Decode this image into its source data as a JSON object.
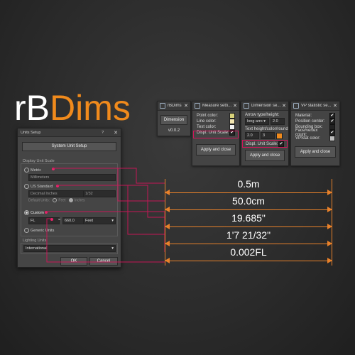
{
  "logo": {
    "part1": "rB",
    "part2": "Dims"
  },
  "colors": {
    "accent": "#f08a1c",
    "highlight": "#d4145a",
    "dimension_line": "#e8812a"
  },
  "panels": {
    "rbdims": {
      "title": "rBDims",
      "button": "Dimension",
      "version": "v0.0.2"
    },
    "measure": {
      "title": "Measure setti...",
      "rows": [
        "Point color:",
        "Line color:",
        "Text color:",
        "Displ. Unit Scale:"
      ],
      "button": "Apply and close"
    },
    "dimension": {
      "title": "Dimension se...",
      "arrow_label": "Arrow type/height:",
      "arrow_type": "long arro",
      "arrow_height": "2.0",
      "text_label": "Text height/color/round:",
      "text_height": "2.0",
      "text_round": "3",
      "scale_label": "Displ. Unit Scale:",
      "button": "Apply and close"
    },
    "vpstat": {
      "title": "VP statistic se...",
      "rows": [
        "Material:",
        "Position center:",
        "Bounding box:",
        "Face/vertex count:",
        "VPStat color:"
      ],
      "button": "Apply and close"
    }
  },
  "units_dialog": {
    "title": "Units Setup",
    "help": "?",
    "system_button": "System Unit Setup",
    "display_group": "Display Unit Scale",
    "metric_label": "Metric",
    "metric_value": "Millimeters",
    "us_label": "US Standard",
    "us_value": "Decimal Inches",
    "us_fraction": "1/32",
    "default_units": "Default Units:",
    "feet": "Feet",
    "inches": "Inches",
    "custom_label": "Custom",
    "custom_name": "FL",
    "custom_equals": "=",
    "custom_value": "660.0",
    "custom_unit": "Feet",
    "generic_label": "Generic Units",
    "lighting_group": "Lighting Units",
    "lighting_value": "International",
    "ok": "OK",
    "cancel": "Cancel"
  },
  "dimensions": [
    "0.5m",
    "50.0cm",
    "19.685\"",
    "1'7 21/32\"",
    "0.002FL"
  ]
}
